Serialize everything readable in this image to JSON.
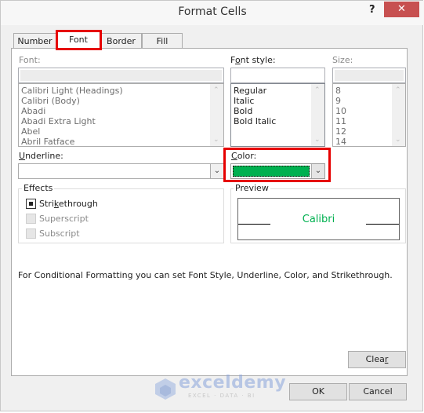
{
  "window": {
    "title": "Format Cells",
    "help_label": "?",
    "close_label": "✕"
  },
  "tabs": [
    {
      "label": "Number",
      "active": false
    },
    {
      "label": "Font",
      "active": true
    },
    {
      "label": "Border",
      "active": false
    },
    {
      "label": "Fill",
      "active": false
    }
  ],
  "font": {
    "label": "Font:",
    "value": "",
    "items": [
      "Calibri Light (Headings)",
      "Calibri (Body)",
      "Abadi",
      "Abadi Extra Light",
      "Abel",
      "Abril Fatface"
    ],
    "disabled": true
  },
  "font_style": {
    "label_pre": "F",
    "label_accel": "o",
    "label_post": "nt style:",
    "value": "",
    "items": [
      "Regular",
      "Italic",
      "Bold",
      "Bold Italic"
    ]
  },
  "size": {
    "label": "Size:",
    "value": "",
    "items": [
      "8",
      "9",
      "10",
      "11",
      "12",
      "14"
    ],
    "disabled": true
  },
  "underline": {
    "label_accel": "U",
    "label_post": "nderline:",
    "value": ""
  },
  "color": {
    "label_accel": "C",
    "label_post": "olor:",
    "swatch": "#00b050"
  },
  "effects": {
    "title": "Effects",
    "items": [
      {
        "label_pre": "Stri",
        "label_accel": "k",
        "label_post": "ethrough",
        "checked": "indeterminate",
        "disabled": false
      },
      {
        "label_pre": "Superscript",
        "label_accel": "",
        "label_post": "",
        "checked": false,
        "disabled": true
      },
      {
        "label_pre": "Subscript",
        "label_accel": "",
        "label_post": "",
        "checked": false,
        "disabled": true
      }
    ]
  },
  "preview": {
    "title": "Preview",
    "sample_text": "Calibri",
    "sample_color": "#00b050"
  },
  "info_text": "For Conditional Formatting you can set Font Style, Underline, Color, and Strikethrough.",
  "buttons": {
    "clear_pre": "Clea",
    "clear_accel": "r",
    "ok": "OK",
    "cancel": "Cancel"
  },
  "watermark": {
    "brand": "exceldemy",
    "tagline": "EXCEL · DATA · BI"
  },
  "highlight_color": "#e60000"
}
